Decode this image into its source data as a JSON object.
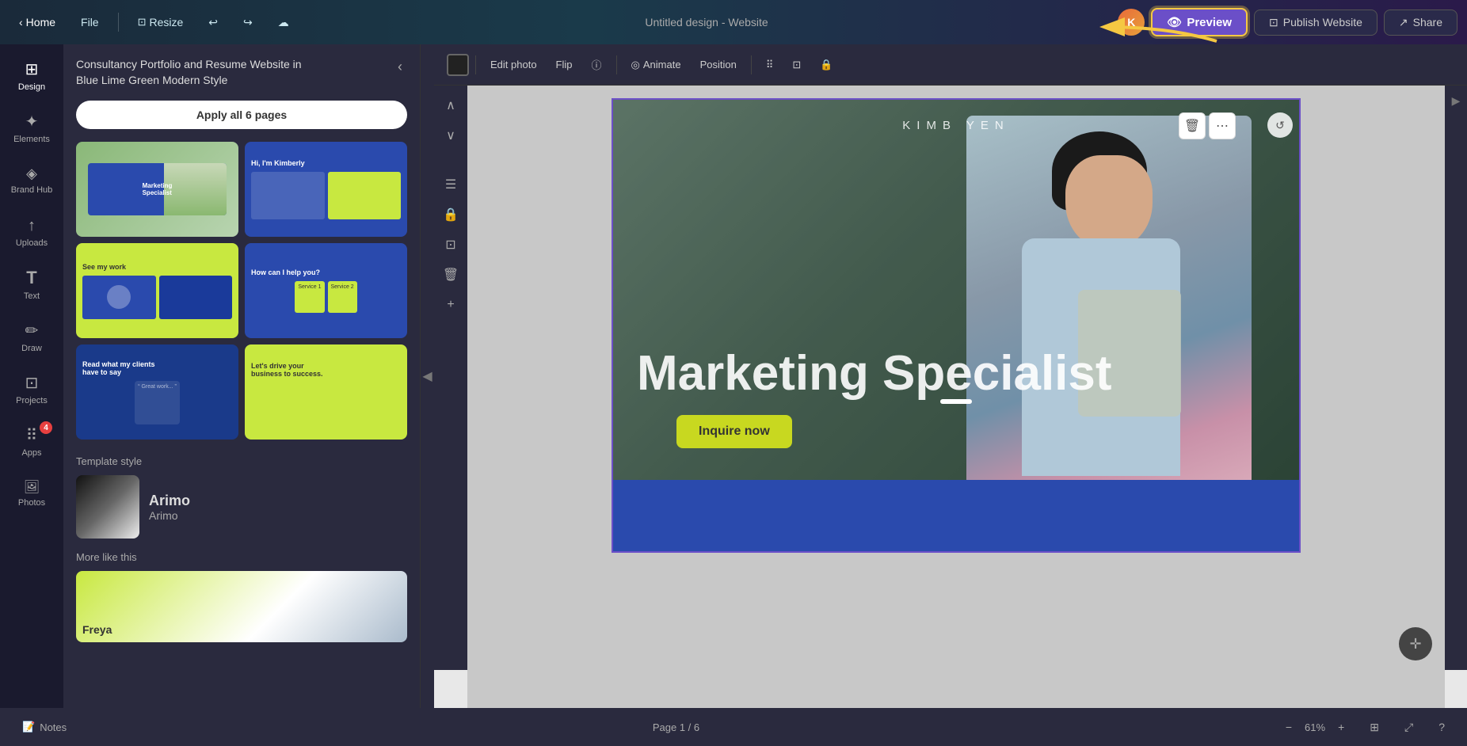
{
  "topbar": {
    "home_label": "Home",
    "file_label": "File",
    "resize_label": "Resize",
    "design_title": "Untitled design - Website",
    "preview_label": "Preview",
    "publish_label": "Publish Website",
    "share_label": "Share",
    "user_initials": "K"
  },
  "sidebar": {
    "items": [
      {
        "id": "design",
        "label": "Design",
        "icon": "⊞"
      },
      {
        "id": "elements",
        "label": "Elements",
        "icon": "✦"
      },
      {
        "id": "brand-hub",
        "label": "Brand Hub",
        "icon": "◈"
      },
      {
        "id": "uploads",
        "label": "Uploads",
        "icon": "↑"
      },
      {
        "id": "text",
        "label": "Text",
        "icon": "T"
      },
      {
        "id": "draw",
        "label": "Draw",
        "icon": "✏"
      },
      {
        "id": "projects",
        "label": "Projects",
        "icon": "⊡"
      },
      {
        "id": "apps",
        "label": "Apps",
        "icon": "⠿",
        "badge": "4"
      },
      {
        "id": "photos",
        "label": "Photos",
        "icon": "🖼"
      }
    ]
  },
  "template_panel": {
    "title": "Consultancy Portfolio and Resume Website in Blue Lime Green Modern Style",
    "apply_btn_label": "Apply all 6 pages",
    "close_icon": "‹",
    "thumbnails": [
      {
        "id": 1,
        "alt": "Marketing Specialist page",
        "label": "Marketing Specialist"
      },
      {
        "id": 2,
        "alt": "Hi Kimberly page",
        "label": "Hi, I'm Kimberly"
      },
      {
        "id": 3,
        "alt": "See my work page",
        "label": "See my work"
      },
      {
        "id": 4,
        "alt": "How can I help page",
        "label": "How can I help you?"
      },
      {
        "id": 5,
        "alt": "Testimonials page",
        "label": "Read what my clients"
      },
      {
        "id": 6,
        "alt": "Lets drive business page",
        "label": "Let's drive your business"
      }
    ],
    "template_style_section": "Template style",
    "style_name": "Arimo",
    "style_sub": "Arimo",
    "more_like_label": "More like this",
    "more_thumb_alt": "Freya template"
  },
  "photo_toolbar": {
    "color_swatch_label": "Color swatch",
    "edit_photo": "Edit photo",
    "flip": "Flip",
    "info_icon": "ⓘ",
    "animate": "Animate",
    "position": "Position",
    "grid_icon": "⠿",
    "crop_icon": "⊡",
    "lock_icon": "🔒"
  },
  "canvas": {
    "hero": {
      "name_text": "KIMB    YEN",
      "title_text": "Marketing Specialist",
      "inquire_btn": "Inquire now",
      "page_indicator": "Page 1 / 6"
    },
    "delete_icon": "🗑",
    "more_icon": "⋯"
  },
  "bottom_bar": {
    "notes_label": "Notes",
    "notes_icon": "📝",
    "page_info": "Page 1 / 6",
    "zoom_percent": "61%",
    "grid_view_icon": "⊞",
    "fullscreen_icon": "⤢",
    "help_icon": "?"
  },
  "scroll_arrows": {
    "up": "∧",
    "down": "∨"
  },
  "arrow_annotation": {
    "color": "#f5c842",
    "points_to": "Preview button"
  }
}
